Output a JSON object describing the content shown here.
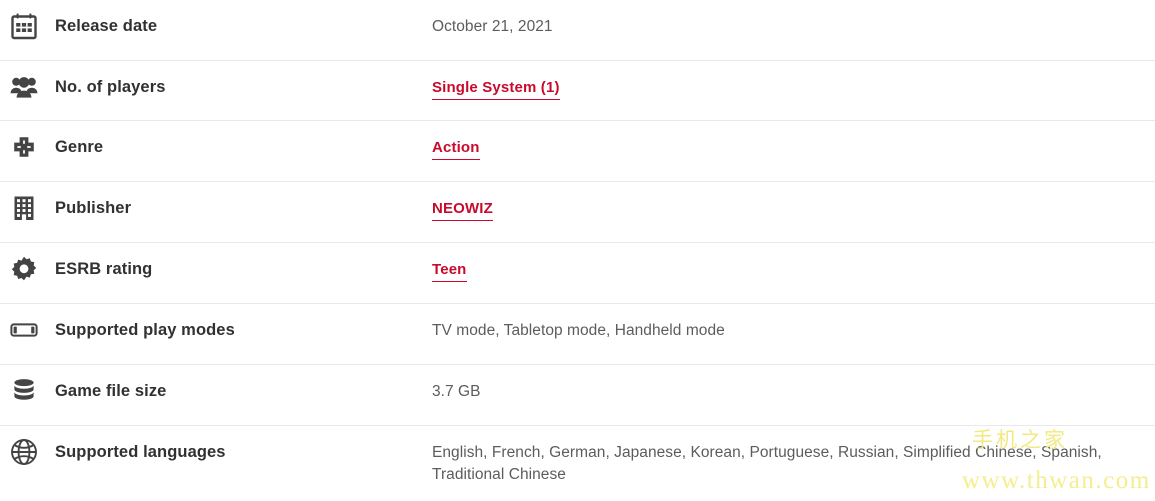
{
  "page": {
    "title": "Game details specification table"
  },
  "rows": [
    {
      "icon": "calendar-icon",
      "label": "Release date",
      "value": "October 21, 2021",
      "is_link": false
    },
    {
      "icon": "players-group-icon",
      "label": "No. of players",
      "value": "Single System (1)",
      "is_link": true
    },
    {
      "icon": "dpad-icon",
      "label": "Genre",
      "value": "Action",
      "is_link": true
    },
    {
      "icon": "building-icon",
      "label": "Publisher",
      "value": "NEOWIZ",
      "is_link": true
    },
    {
      "icon": "gear-icon",
      "label": "ESRB rating",
      "value": "Teen",
      "is_link": true
    },
    {
      "icon": "switch-console-icon",
      "label": "Supported play modes",
      "value": "TV mode, Tabletop mode, Handheld mode",
      "is_link": false
    },
    {
      "icon": "database-icon",
      "label": "Game file size",
      "value": "3.7 GB",
      "is_link": false
    },
    {
      "icon": "globe-icon",
      "label": "Supported languages",
      "value": "English, French, German, Japanese, Korean, Portuguese, Russian, Simplified Chinese, Spanish, Traditional Chinese",
      "is_link": false
    }
  ],
  "watermark": {
    "chinese_text": "手机之家",
    "url_text": "www.thwan.com"
  },
  "colors": {
    "link_red": "#c90a2c",
    "label_text": "#313131",
    "value_text": "#5c5c5c",
    "divider": "#e9e9e9",
    "icon_dark": "#444444",
    "watermark_yellow": "#f5ee90",
    "background": "#ffffff"
  }
}
